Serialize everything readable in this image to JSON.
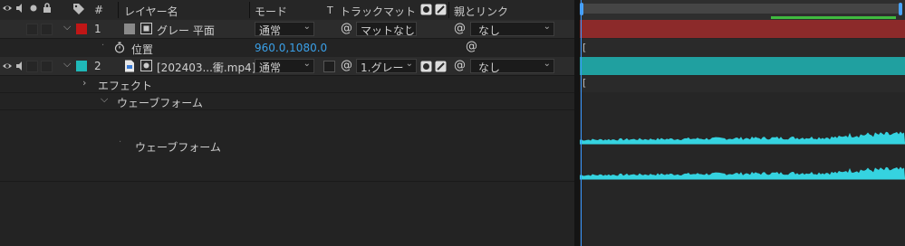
{
  "header": {
    "col_num": "#",
    "col_layer_name": "レイヤー名",
    "col_mode": "モード",
    "col_t": "T",
    "col_track_matte": "トラックマット",
    "col_parent_link": "親とリンク"
  },
  "layers": [
    {
      "number": "1",
      "name": "グレー 平面",
      "label_color": "#c01616",
      "mode": "通常",
      "track_matte": "マットなし",
      "parent": "なし",
      "property": {
        "name": "位置",
        "value": "960.0,1080.0"
      },
      "bar_color": "#8c2a2a"
    },
    {
      "number": "2",
      "name": "[202403...衝.mp4]",
      "label_color": "#1fb8b8",
      "mode": "通常",
      "track_matte": "1.グレー",
      "parent": "なし",
      "bar_color": "#20a0a0",
      "groups": {
        "effect": "エフェクト",
        "waveform_group": "ウェーブフォーム",
        "waveform_item": "ウェーブフォーム"
      }
    }
  ],
  "timeline": {
    "waveform_color": "#35d3e0",
    "work_area_color": "#4aa3ff",
    "render_bar_color": "#3fba3f"
  }
}
